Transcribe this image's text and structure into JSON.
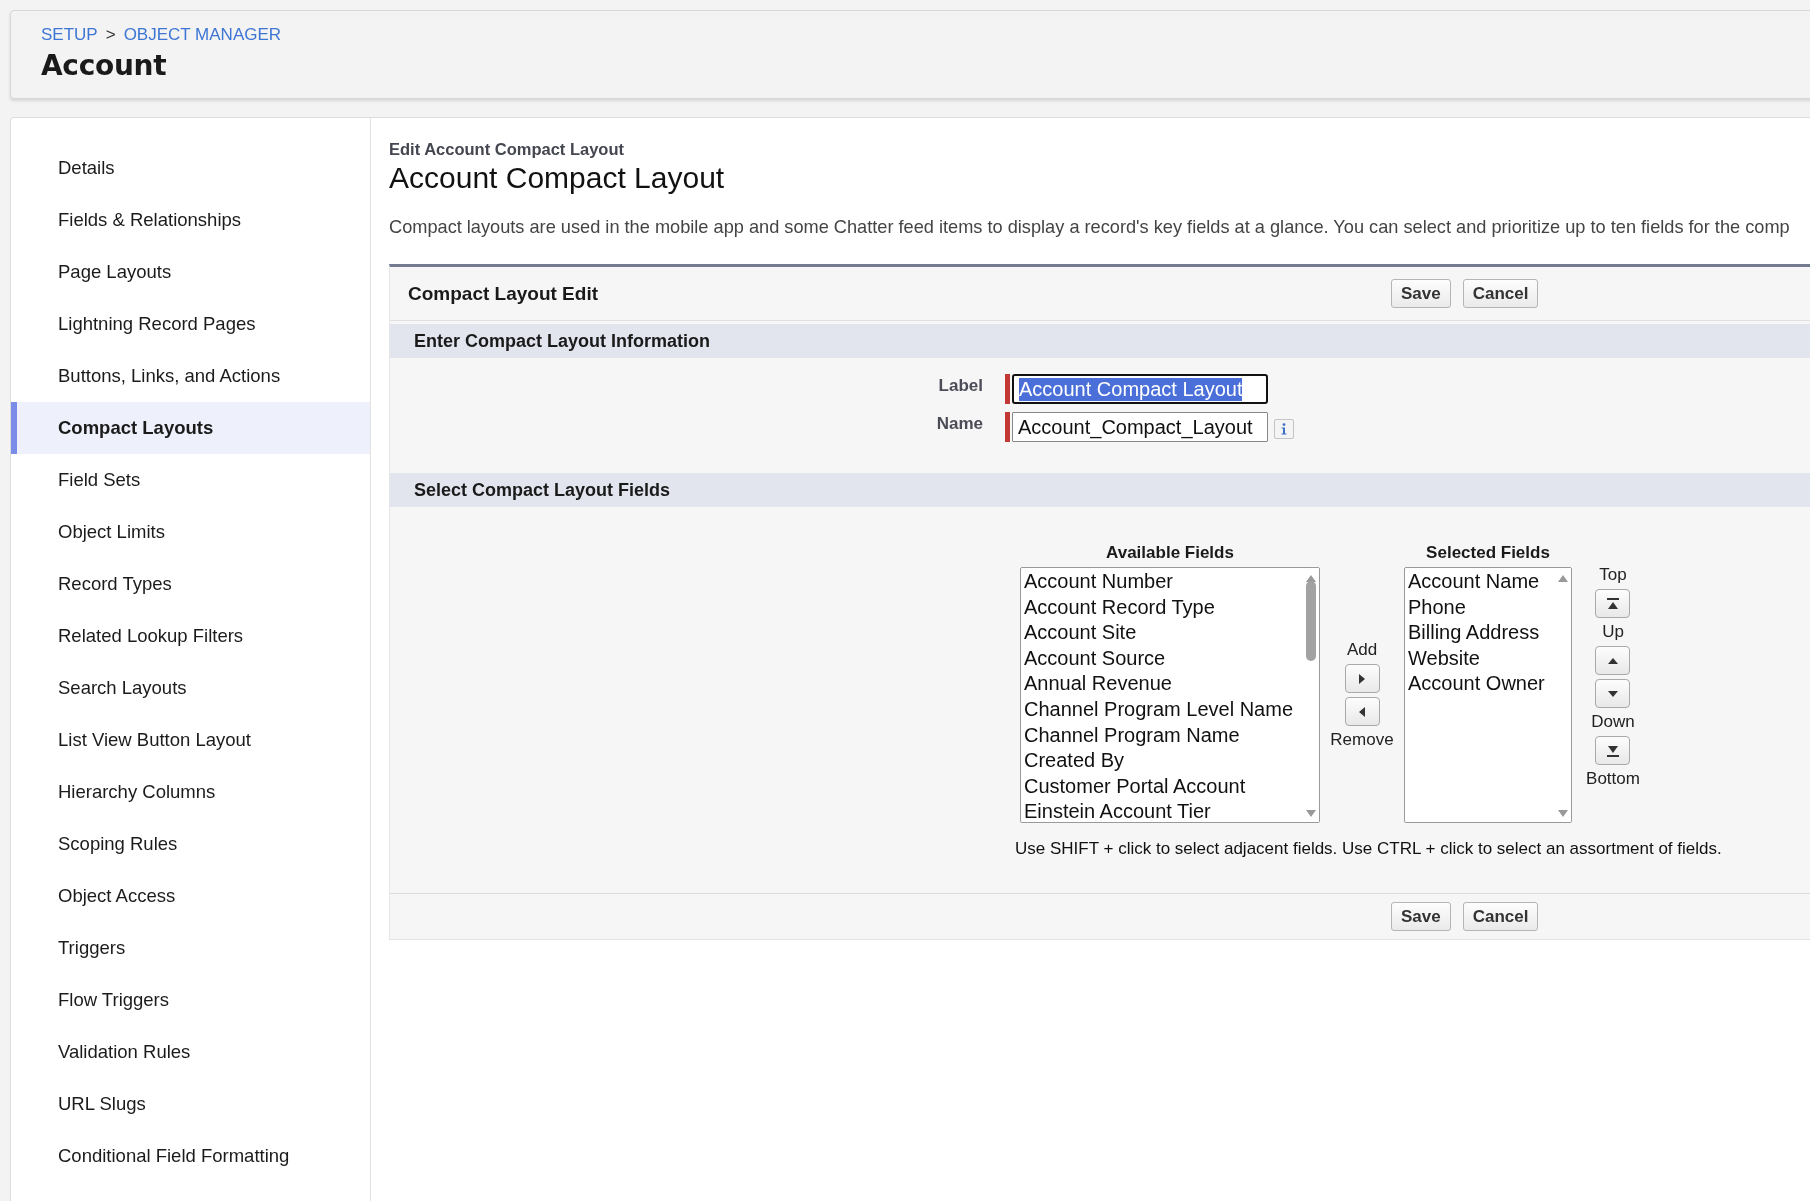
{
  "breadcrumb": {
    "items": [
      "SETUP",
      "OBJECT MANAGER"
    ],
    "separator": ">"
  },
  "page_title": "Account",
  "sidebar": {
    "items": [
      {
        "label": "Details",
        "selected": false
      },
      {
        "label": "Fields & Relationships",
        "selected": false
      },
      {
        "label": "Page Layouts",
        "selected": false
      },
      {
        "label": "Lightning Record Pages",
        "selected": false
      },
      {
        "label": "Buttons, Links, and Actions",
        "selected": false
      },
      {
        "label": "Compact Layouts",
        "selected": true
      },
      {
        "label": "Field Sets",
        "selected": false
      },
      {
        "label": "Object Limits",
        "selected": false
      },
      {
        "label": "Record Types",
        "selected": false
      },
      {
        "label": "Related Lookup Filters",
        "selected": false
      },
      {
        "label": "Search Layouts",
        "selected": false
      },
      {
        "label": "List View Button Layout",
        "selected": false
      },
      {
        "label": "Hierarchy Columns",
        "selected": false
      },
      {
        "label": "Scoping Rules",
        "selected": false
      },
      {
        "label": "Object Access",
        "selected": false
      },
      {
        "label": "Triggers",
        "selected": false
      },
      {
        "label": "Flow Triggers",
        "selected": false
      },
      {
        "label": "Validation Rules",
        "selected": false
      },
      {
        "label": "URL Slugs",
        "selected": false
      },
      {
        "label": "Conditional Field Formatting",
        "selected": false
      }
    ]
  },
  "content": {
    "eyebrow": "Edit Account Compact Layout",
    "title": "Account Compact Layout",
    "description": "Compact layouts are used in the mobile app and some Chatter feed items to display a record's key fields at a glance. You can select and prioritize up to ten fields for the comp"
  },
  "form": {
    "title": "Compact Layout Edit",
    "top_buttons": [
      "Save",
      "Cancel"
    ],
    "info_section": {
      "title": "Enter Compact Layout Information",
      "fields": [
        {
          "label": "Label",
          "value": "Account Compact Layout",
          "required": true,
          "focused": true,
          "text_selected": true,
          "info": false
        },
        {
          "label": "Name",
          "value": "Account_Compact_Layout",
          "required": true,
          "focused": false,
          "text_selected": false,
          "info": true
        }
      ]
    },
    "fields_section": {
      "title": "Select Compact Layout Fields",
      "available": {
        "heading": "Available Fields",
        "options": [
          "Account Number",
          "Account Record Type",
          "Account Site",
          "Account Source",
          "Annual Revenue",
          "Channel Program Level Name",
          "Channel Program Name",
          "Created By",
          "Customer Portal Account",
          "Einstein Account Tier"
        ],
        "scroll_thumb": true
      },
      "transfer": [
        {
          "kind": "label",
          "text": "Add"
        },
        {
          "kind": "right"
        },
        {
          "kind": "left"
        },
        {
          "kind": "label",
          "text": "Remove"
        }
      ],
      "selected": {
        "heading": "Selected Fields",
        "options": [
          "Account Name",
          "Phone",
          "Billing Address",
          "Website",
          "Account Owner"
        ],
        "scroll_thumb": false
      },
      "order": [
        {
          "kind": "label",
          "text": "Top"
        },
        {
          "kind": "top"
        },
        {
          "kind": "label",
          "text": "Up"
        },
        {
          "kind": "up"
        },
        {
          "kind": "down"
        },
        {
          "kind": "label",
          "text": "Down"
        },
        {
          "kind": "bottom"
        },
        {
          "kind": "label",
          "text": "Bottom"
        }
      ],
      "hint": "Use SHIFT + click to select adjacent fields. Use CTRL + click to select an assortment of fields."
    },
    "bottom_buttons": [
      "Save",
      "Cancel"
    ]
  }
}
